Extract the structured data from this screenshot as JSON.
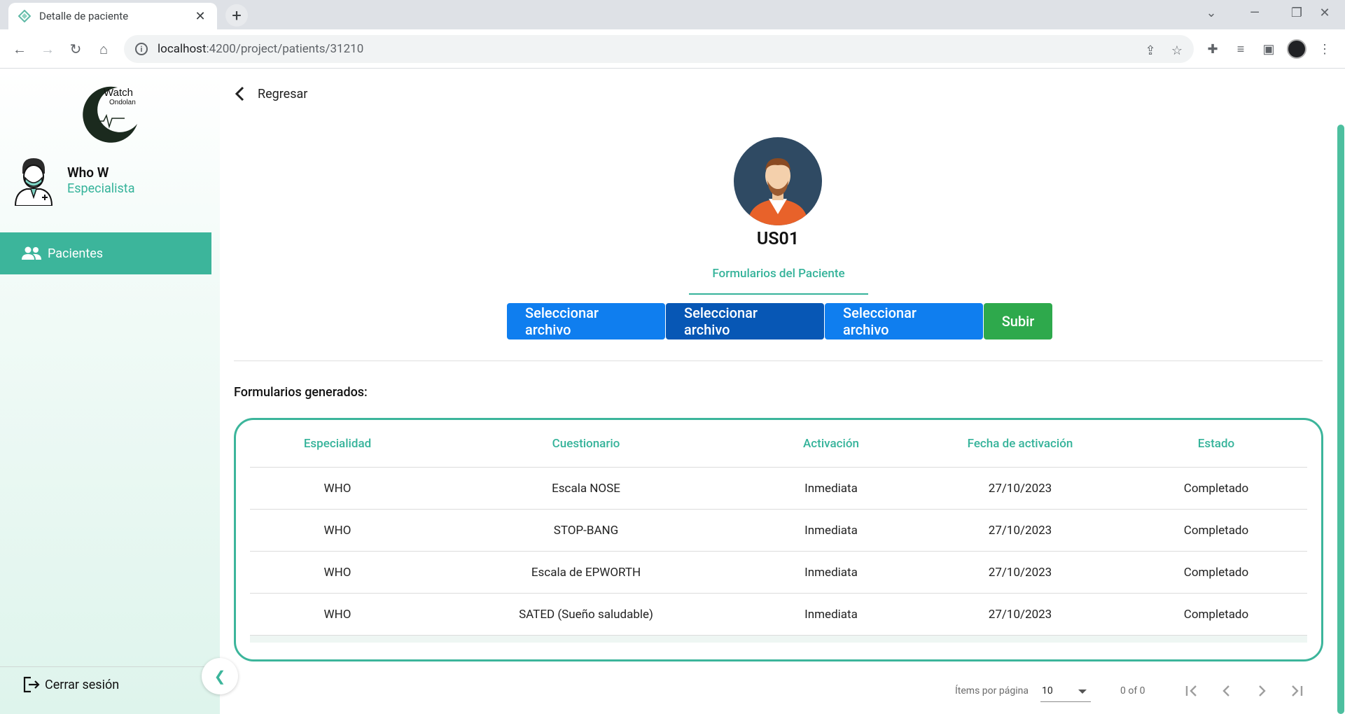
{
  "browser": {
    "tab_title": "Detalle de paciente",
    "url_host": "localhost",
    "url_path": ":4200/project/patients/31210"
  },
  "sidebar": {
    "logo_text": "Watch Ondolan",
    "user_name": "Who W",
    "user_role": "Especialista",
    "menu_active_label": "Pacientes",
    "logout_label": "Cerrar sesión"
  },
  "main": {
    "back_label": "Regresar",
    "patient_id": "US01",
    "tab_label": "Formularios del Paciente",
    "buttons": {
      "select1": "Seleccionar archivo",
      "select2": "Seleccionar archivo",
      "select3": "Seleccionar archivo",
      "upload": "Subir"
    },
    "section_title": "Formularios generados:",
    "table": {
      "headers": [
        "Especialidad",
        "Cuestionario",
        "Activación",
        "Fecha de activación",
        "Estado"
      ],
      "rows": [
        [
          "WHO",
          "Escala NOSE",
          "Inmediata",
          "27/10/2023",
          "Completado"
        ],
        [
          "WHO",
          "STOP-BANG",
          "Inmediata",
          "27/10/2023",
          "Completado"
        ],
        [
          "WHO",
          "Escala de EPWORTH",
          "Inmediata",
          "27/10/2023",
          "Completado"
        ],
        [
          "WHO",
          "SATED (Sueño saludable)",
          "Inmediata",
          "27/10/2023",
          "Completado"
        ]
      ]
    },
    "paginator": {
      "items_label": "Ítems por página",
      "page_size": "10",
      "range": "0 of 0"
    }
  },
  "colors": {
    "accent": "#3cb59b",
    "button_blue": "#0f7eef",
    "button_blue_active": "#0757b5",
    "button_green": "#2ea94c"
  }
}
